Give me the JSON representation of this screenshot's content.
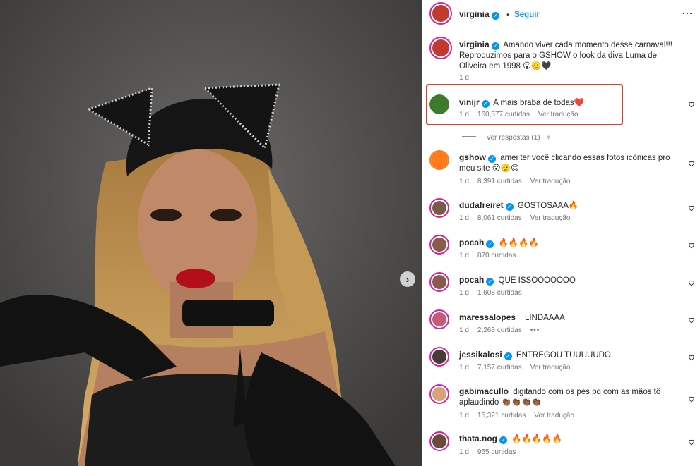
{
  "post": {
    "author": "virginia",
    "follow_label": "Seguir",
    "dot": "•",
    "caption": "Amando viver cada momento desse carnaval!!! Reproduzimos para o GSHOW o look da diva Luma de Oliveira em 1998 😮🫡🖤",
    "caption_age": "1 d"
  },
  "colors": {
    "highlight_border": "#e0402a",
    "verified": "#0095f6",
    "link_blue": "#0095f6"
  },
  "replies_label": "Ver respostas (1)",
  "comments": [
    {
      "user": "vinijr",
      "verified": true,
      "text": "A mais braba de todas❤️",
      "age": "1 d",
      "likes": "160,677 curtidas",
      "translate": "Ver tradução"
    },
    {
      "user": "gshow",
      "verified": true,
      "text": "amei ter você clicando essas fotos icônicas pro meu site 😮🫡😍",
      "age": "1 d",
      "likes": "8,391 curtidas",
      "translate": "Ver tradução"
    },
    {
      "user": "dudafreiret",
      "verified": true,
      "text": "GOSTOSAAA🔥",
      "age": "1 d",
      "likes": "8,061 curtidas",
      "translate": "Ver tradução"
    },
    {
      "user": "pocah",
      "verified": true,
      "text": "🔥🔥🔥🔥",
      "age": "1 d",
      "likes": "870 curtidas",
      "translate": ""
    },
    {
      "user": "pocah",
      "verified": true,
      "text": "QUE ISSOOOOOOO",
      "age": "1 d",
      "likes": "1,608 curtidas",
      "translate": ""
    },
    {
      "user": "maressalopes_",
      "verified": false,
      "text": "LINDAAAA",
      "age": "1 d",
      "likes": "2,263 curtidas",
      "translate": "•••"
    },
    {
      "user": "jessikalosi",
      "verified": true,
      "text": "ENTREGOU TUUUUUDO!",
      "age": "1 d",
      "likes": "7,157 curtidas",
      "translate": "Ver tradução"
    },
    {
      "user": "gabimacullo",
      "verified": false,
      "text": "digitando com os pés pq com as mãos tô aplaudindo 👏🏾👏🏾👏🏾👏🏾",
      "age": "1 d",
      "likes": "15,321 curtidas",
      "translate": "Ver tradução"
    },
    {
      "user": "thata.nog",
      "verified": true,
      "text": "🔥🔥🔥🔥🔥",
      "age": "1 d",
      "likes": "955 curtidas",
      "translate": ""
    }
  ]
}
